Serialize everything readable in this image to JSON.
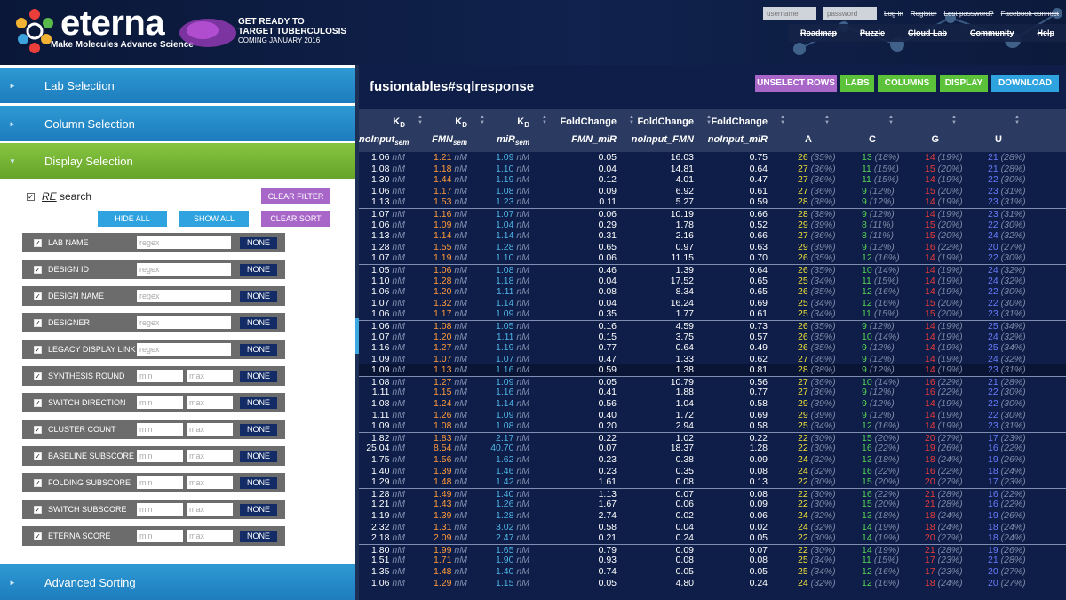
{
  "header": {
    "logo_word": "eterna",
    "tagline": "Make Molecules  Advance Science",
    "promo_line1": "GET READY TO",
    "promo_line2": "TARGET TUBERCULOSIS",
    "promo_sub": "COMING JANUARY 2016",
    "username_placeholder": "username",
    "password_placeholder": "password",
    "links": [
      "Log in",
      "Register",
      "Lost password?",
      "Facebook connect"
    ],
    "nav": [
      "Roadmap",
      "Puzzle",
      "Cloud Lab",
      "Community",
      "Help"
    ]
  },
  "left": {
    "sections": {
      "lab": "Lab Selection",
      "column": "Column Selection",
      "display": "Display Selection",
      "sorting": "Advanced Sorting"
    },
    "re_label": "RE",
    "re_text": " search",
    "clear_filter": "CLEAR FILTER",
    "hide_all": "HIDE ALL",
    "show_all": "SHOW ALL",
    "clear_sort": "CLEAR SORT",
    "none_label": "NONE",
    "regex_placeholder": "regex",
    "min_placeholder": "min",
    "max_placeholder": "max",
    "columns": [
      {
        "label": "LAB NAME",
        "type": "regex"
      },
      {
        "label": "DESIGN ID",
        "type": "regex"
      },
      {
        "label": "DESIGN NAME",
        "type": "regex"
      },
      {
        "label": "DESIGNER",
        "type": "regex"
      },
      {
        "label": "LEGACY DISPLAY LINK",
        "type": "regex"
      },
      {
        "label": "SYNTHESIS ROUND",
        "type": "range"
      },
      {
        "label": "SWITCH DIRECTION",
        "type": "range"
      },
      {
        "label": "CLUSTER COUNT",
        "type": "range"
      },
      {
        "label": "BASELINE SUBSCORE",
        "type": "range"
      },
      {
        "label": "FOLDING SUBSCORE",
        "type": "range"
      },
      {
        "label": "SWITCH SUBSCORE",
        "type": "range"
      },
      {
        "label": "ETERNA SCORE",
        "type": "range"
      }
    ]
  },
  "right": {
    "title": "fusiontables#sqlresponse",
    "buttons": {
      "unselect": "UNSELECT ROWS",
      "labs": "LABS",
      "columns": "COLUMNS",
      "display": "DISPLAY",
      "download": "DOWNLOAD"
    },
    "colors": {
      "unselect": "#a866c9",
      "labs": "#5cc23a",
      "columns": "#5cc23a",
      "display": "#5cc23a",
      "download": "#2ea3e0"
    },
    "headers_top": [
      "KD",
      "KD",
      "KD",
      "FoldChange",
      "FoldChange",
      "FoldChange",
      "",
      "",
      "",
      "",
      "A"
    ],
    "headers_bottom": [
      "noInput_sem",
      "FMN_sem",
      "miR_sem",
      "FMN_miR",
      "noInput_FMN",
      "noInput_miR",
      "A",
      "C",
      "G",
      "U",
      "(%"
    ],
    "unit": "nM",
    "rows": [
      [
        1.06,
        1.21,
        1.09,
        "0.05",
        "16.03",
        "0.75",
        26,
        35,
        13,
        18,
        14,
        19,
        21,
        28
      ],
      [
        1.08,
        1.18,
        1.1,
        "0.04",
        "14.81",
        "0.64",
        27,
        36,
        11,
        15,
        15,
        20,
        21,
        28
      ],
      [
        1.3,
        1.44,
        1.19,
        "0.12",
        "4.01",
        "0.47",
        27,
        36,
        11,
        15,
        14,
        19,
        22,
        30
      ],
      [
        1.06,
        1.17,
        1.08,
        "0.09",
        "6.92",
        "0.61",
        27,
        36,
        9,
        12,
        15,
        20,
        23,
        31
      ],
      [
        1.13,
        1.53,
        1.23,
        "0.11",
        "5.27",
        "0.59",
        28,
        38,
        9,
        12,
        14,
        19,
        23,
        31
      ],
      [
        1.07,
        1.16,
        1.07,
        "0.06",
        "10.19",
        "0.66",
        28,
        38,
        9,
        12,
        14,
        19,
        23,
        31
      ],
      [
        1.06,
        1.09,
        1.04,
        "0.29",
        "1.78",
        "0.52",
        29,
        39,
        8,
        11,
        15,
        20,
        22,
        30
      ],
      [
        1.13,
        1.14,
        1.14,
        "0.31",
        "2.16",
        "0.66",
        27,
        36,
        8,
        11,
        15,
        20,
        24,
        32
      ],
      [
        1.28,
        1.55,
        1.28,
        "0.65",
        "0.97",
        "0.63",
        29,
        39,
        9,
        12,
        16,
        22,
        20,
        27
      ],
      [
        1.07,
        1.19,
        1.1,
        "0.06",
        "11.15",
        "0.70",
        26,
        35,
        12,
        16,
        14,
        19,
        22,
        30
      ],
      [
        1.05,
        1.06,
        1.08,
        "0.46",
        "1.39",
        "0.64",
        26,
        35,
        10,
        14,
        14,
        19,
        24,
        32
      ],
      [
        1.1,
        1.28,
        1.18,
        "0.04",
        "17.52",
        "0.65",
        25,
        34,
        11,
        15,
        14,
        19,
        24,
        32
      ],
      [
        1.06,
        1.2,
        1.11,
        "0.08",
        "8.34",
        "0.65",
        26,
        35,
        12,
        16,
        14,
        19,
        22,
        30
      ],
      [
        1.07,
        1.32,
        1.14,
        "0.04",
        "16.24",
        "0.69",
        25,
        34,
        12,
        16,
        15,
        20,
        22,
        30
      ],
      [
        1.06,
        1.17,
        1.09,
        "0.35",
        "1.77",
        "0.61",
        25,
        34,
        11,
        15,
        15,
        20,
        23,
        31
      ],
      [
        1.06,
        1.08,
        1.05,
        "0.16",
        "4.59",
        "0.73",
        26,
        35,
        9,
        12,
        14,
        19,
        25,
        34
      ],
      [
        1.07,
        1.2,
        1.11,
        "0.15",
        "3.75",
        "0.57",
        26,
        35,
        10,
        14,
        14,
        19,
        24,
        32
      ],
      [
        1.16,
        1.27,
        1.19,
        "0.77",
        "0.64",
        "0.49",
        26,
        35,
        9,
        12,
        14,
        19,
        25,
        34
      ],
      [
        1.09,
        1.07,
        1.07,
        "0.47",
        "1.33",
        "0.62",
        27,
        36,
        9,
        12,
        14,
        19,
        24,
        32
      ],
      [
        1.09,
        1.13,
        1.16,
        "0.59",
        "1.38",
        "0.81",
        28,
        38,
        9,
        12,
        14,
        19,
        23,
        31
      ],
      [
        1.08,
        1.27,
        1.09,
        "0.05",
        "10.79",
        "0.56",
        27,
        36,
        10,
        14,
        16,
        22,
        21,
        28
      ],
      [
        1.11,
        1.15,
        1.16,
        "0.41",
        "1.88",
        "0.77",
        27,
        36,
        9,
        12,
        16,
        22,
        22,
        30
      ],
      [
        1.08,
        1.24,
        1.14,
        "0.56",
        "1.04",
        "0.58",
        29,
        39,
        9,
        12,
        14,
        19,
        22,
        30
      ],
      [
        1.11,
        1.26,
        1.09,
        "0.40",
        "1.72",
        "0.69",
        29,
        39,
        9,
        12,
        14,
        19,
        22,
        30
      ],
      [
        1.09,
        1.08,
        1.08,
        "0.20",
        "2.94",
        "0.58",
        25,
        34,
        12,
        16,
        14,
        19,
        23,
        31
      ],
      [
        1.82,
        1.83,
        2.17,
        "0.22",
        "1.02",
        "0.22",
        22,
        30,
        15,
        20,
        20,
        27,
        17,
        23
      ],
      [
        25.04,
        8.54,
        40.7,
        "0.07",
        "18.37",
        "1.28",
        22,
        30,
        16,
        22,
        19,
        26,
        16,
        22
      ],
      [
        1.75,
        1.56,
        1.62,
        "0.23",
        "0.38",
        "0.09",
        24,
        32,
        13,
        18,
        18,
        24,
        19,
        26
      ],
      [
        1.4,
        1.39,
        1.46,
        "0.23",
        "0.35",
        "0.08",
        24,
        32,
        16,
        22,
        16,
        22,
        18,
        24
      ],
      [
        1.29,
        1.48,
        1.42,
        "1.61",
        "0.08",
        "0.13",
        22,
        30,
        15,
        20,
        20,
        27,
        17,
        23
      ],
      [
        1.28,
        1.49,
        1.4,
        "1.13",
        "0.07",
        "0.08",
        22,
        30,
        16,
        22,
        21,
        28,
        16,
        22
      ],
      [
        1.21,
        1.43,
        1.26,
        "1.67",
        "0.06",
        "0.09",
        22,
        30,
        15,
        20,
        21,
        28,
        16,
        22
      ],
      [
        1.19,
        1.39,
        1.28,
        "2.74",
        "0.02",
        "0.06",
        24,
        32,
        13,
        18,
        18,
        24,
        19,
        26
      ],
      [
        2.32,
        1.31,
        3.02,
        "0.58",
        "0.04",
        "0.02",
        24,
        32,
        14,
        19,
        18,
        24,
        18,
        24
      ],
      [
        2.18,
        2.09,
        2.47,
        "0.21",
        "0.24",
        "0.05",
        22,
        30,
        14,
        19,
        20,
        27,
        18,
        24
      ],
      [
        1.8,
        1.99,
        1.65,
        "0.79",
        "0.09",
        "0.07",
        22,
        30,
        14,
        19,
        21,
        28,
        19,
        26
      ],
      [
        1.51,
        1.71,
        1.9,
        "0.93",
        "0.08",
        "0.08",
        25,
        34,
        11,
        15,
        17,
        23,
        21,
        28
      ],
      [
        1.35,
        1.48,
        1.4,
        "0.74",
        "0.05",
        "0.05",
        25,
        34,
        12,
        16,
        17,
        23,
        20,
        27
      ],
      [
        1.06,
        1.29,
        1.15,
        "0.05",
        "4.80",
        "0.24",
        24,
        32,
        12,
        16,
        18,
        24,
        20,
        27
      ]
    ]
  }
}
